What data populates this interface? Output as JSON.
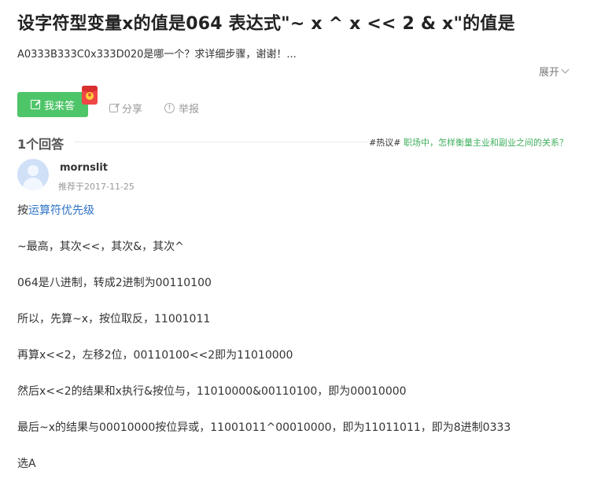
{
  "question": {
    "title": "设字符型变量x的值是064 表达式\"~ x ^ x << 2 & x\"的值是",
    "description": "A0333B333C0x333D020是哪一个？求详细步骤，谢谢！...",
    "expand_label": "展开"
  },
  "actions": {
    "answer_label": "我来答",
    "share_label": "分享",
    "report_label": "举报"
  },
  "answers": {
    "count_label": "1个回答",
    "hot_tag": "#热议#",
    "hot_link": "职场中，怎样衡量主业和副业之间的关系？"
  },
  "answer": {
    "user": "mornslit",
    "recommended": "推荐于2017-11-25",
    "line1_prefix": "按",
    "line1_link": "运算符优先级",
    "lines": [
      "~最高，其次<<，其次&，其次^",
      "064是八进制，转成2进制为00110100",
      "所以，先算~x，按位取反，11001011",
      "再算x<<2，左移2位，00110100<<2即为11010000",
      "然后x<<2的结果和x执行&按位与，11010000&00110100，即为00010000",
      "最后~x的结果与00010000按位异或，11001011^00010000，即为11011011，即为8进制0333",
      "选A"
    ]
  },
  "colors": {
    "accent_green": "#4ec568",
    "link_blue": "#2e72c8",
    "hot_green": "#3eaf5c"
  },
  "icons": {
    "answer": "pen-icon",
    "share": "share-icon",
    "report": "report-icon",
    "expand": "chevron-down-icon",
    "badge": "red-packet-icon"
  }
}
